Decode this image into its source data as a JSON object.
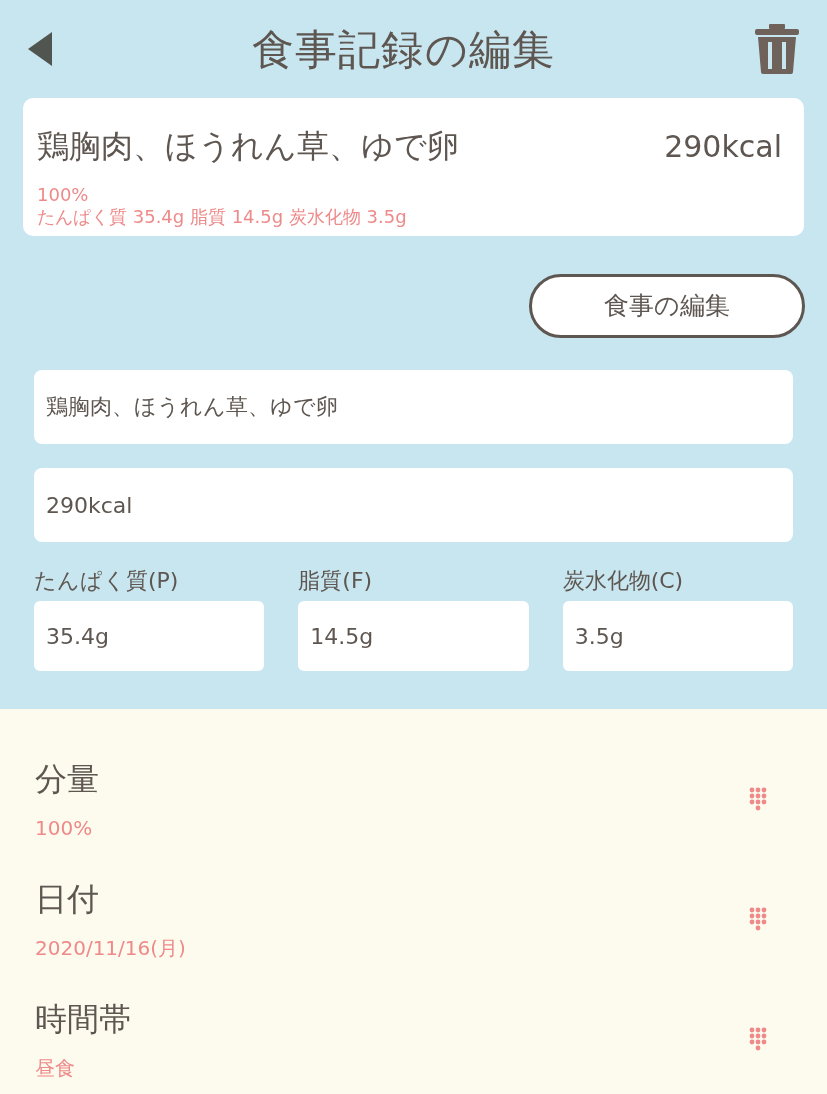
{
  "header": {
    "title": "食事記録の編集"
  },
  "summary": {
    "name": "鶏胸肉、ほうれん草、ゆで卵",
    "calories": "290kcal",
    "portion": "100%",
    "nutrients": "たんぱく質 35.4g 脂質 14.5g 炭水化物 3.5g"
  },
  "edit_button": {
    "label": "食事の編集"
  },
  "fields": [
    {
      "value": "鶏胸肉、ほうれん草、ゆで卵"
    },
    {
      "value": "290kcal"
    }
  ],
  "macros": [
    {
      "label": "たんぱく質(P)",
      "value": "35.4g"
    },
    {
      "label": "脂質(F)",
      "value": "14.5g"
    },
    {
      "label": "炭水化物(C)",
      "value": "3.5g"
    }
  ],
  "settings": [
    {
      "label": "分量",
      "value": "100%"
    },
    {
      "label": "日付",
      "value": "2020/11/16(月)"
    },
    {
      "label": "時間帯",
      "value": "昼食"
    }
  ]
}
